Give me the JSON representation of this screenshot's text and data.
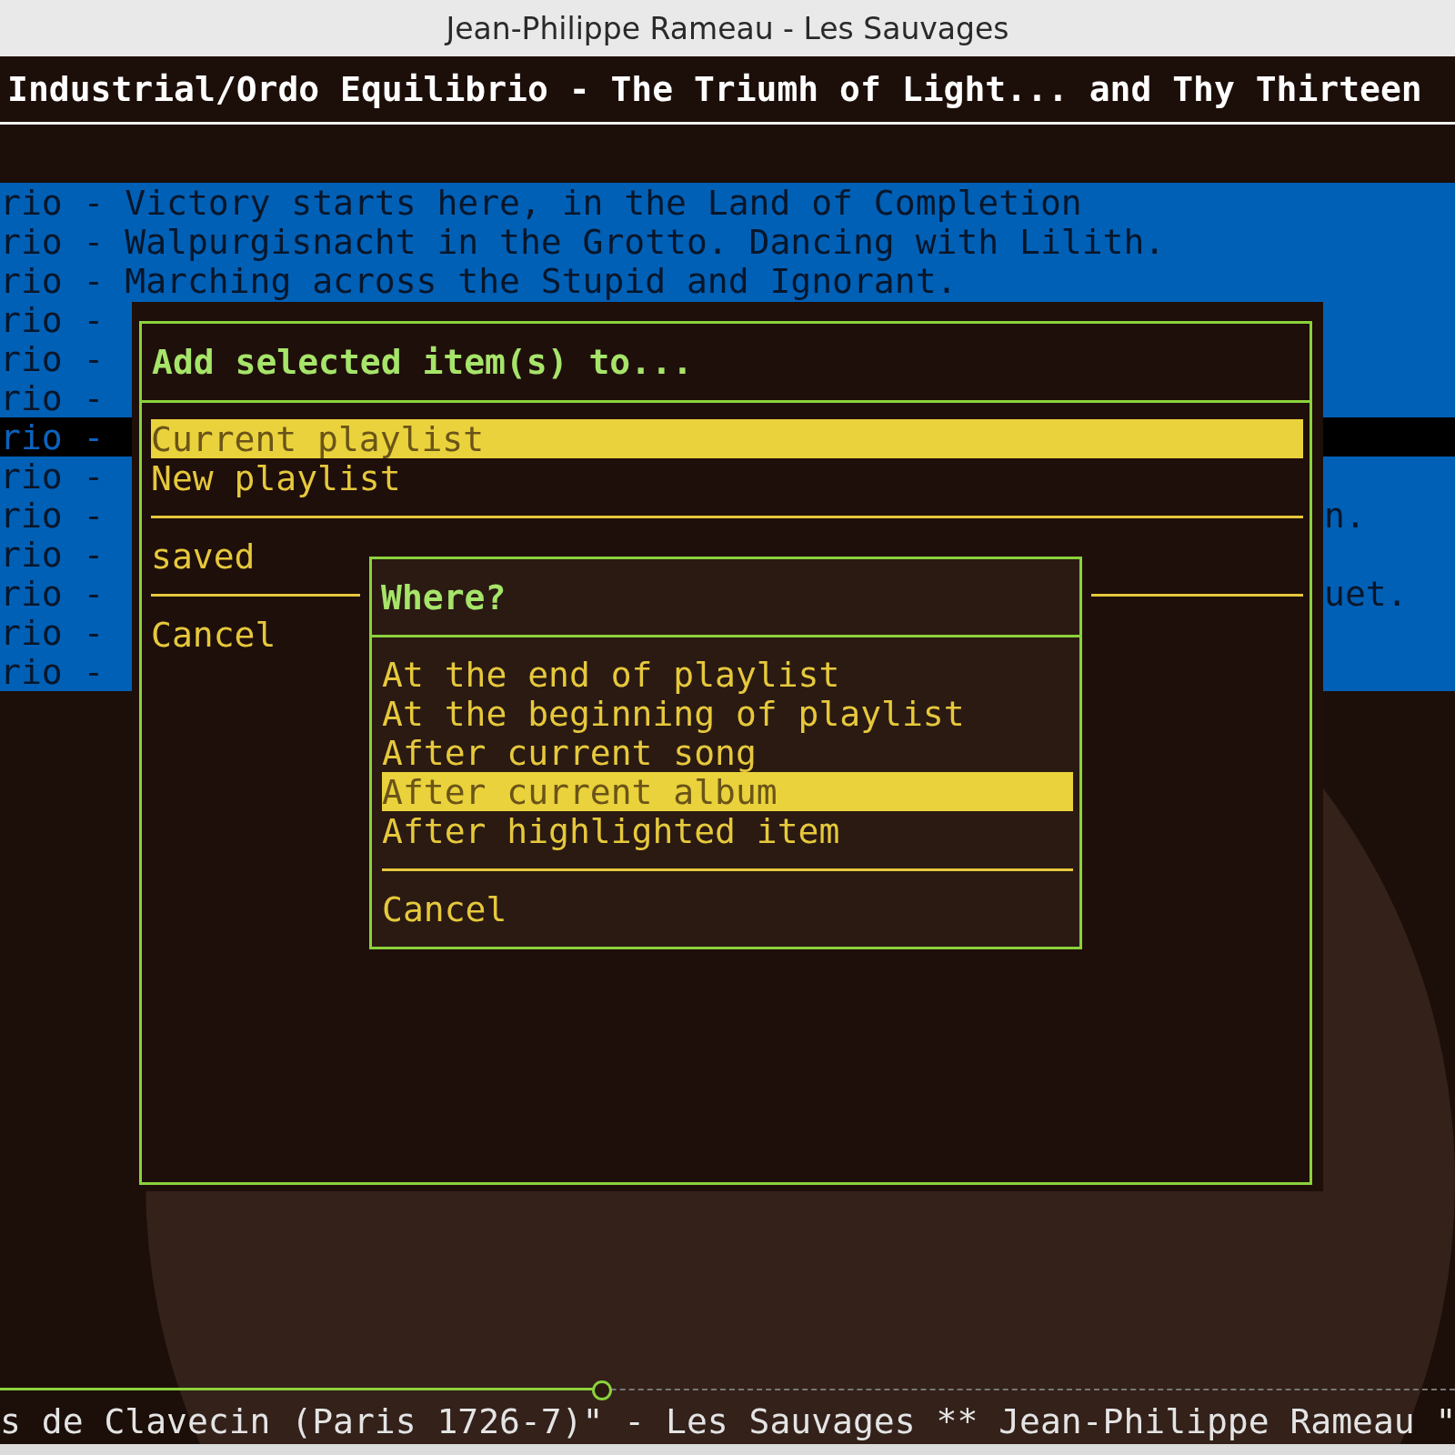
{
  "window": {
    "title": "Jean-Philippe Rameau - Les Sauvages"
  },
  "header": {
    "text": "Industrial/Ordo Equilibrio - The Triumh of Light... and Thy Thirteen"
  },
  "playlist": {
    "rows": [
      {
        "text": "rio - Victory starts here, in the Land of Completion",
        "selected": true,
        "highlighted": false
      },
      {
        "text": "rio - Walpurgisnacht in the Grotto. Dancing with Lilith.",
        "selected": true,
        "highlighted": false
      },
      {
        "text": "rio - Marching across the Stupid and Ignorant.",
        "selected": true,
        "highlighted": false
      },
      {
        "text": "rio -",
        "selected": true,
        "highlighted": false
      },
      {
        "text": "rio -",
        "selected": true,
        "highlighted": false
      },
      {
        "text": "rio -",
        "selected": true,
        "highlighted": false
      },
      {
        "text": "rio -",
        "selected": true,
        "highlighted": true
      },
      {
        "text": "rio -",
        "selected": true,
        "highlighted": false
      },
      {
        "text": "rio -",
        "end_text": "n.",
        "selected": true,
        "highlighted": false
      },
      {
        "text": "rio -",
        "selected": true,
        "highlighted": false
      },
      {
        "text": "rio -",
        "end_text": "uet.",
        "selected": true,
        "highlighted": false
      },
      {
        "text": "rio -",
        "selected": true,
        "highlighted": false
      },
      {
        "text": "rio -",
        "selected": true,
        "highlighted": false
      }
    ]
  },
  "add_dialog": {
    "title": "Add selected item(s) to...",
    "items": [
      {
        "kind": "option",
        "label": "Current playlist",
        "selected": true
      },
      {
        "kind": "option",
        "label": "New playlist",
        "selected": false
      },
      {
        "kind": "separator"
      },
      {
        "kind": "option",
        "label": "saved",
        "selected": false
      },
      {
        "kind": "separator"
      },
      {
        "kind": "option",
        "label": "Cancel",
        "selected": false
      }
    ]
  },
  "where_dialog": {
    "title": "Where?",
    "items": [
      {
        "kind": "option",
        "label": "At the end of playlist",
        "selected": false
      },
      {
        "kind": "option",
        "label": "At the beginning of playlist",
        "selected": false
      },
      {
        "kind": "option",
        "label": "After current song",
        "selected": false
      },
      {
        "kind": "option",
        "label": "After current album",
        "selected": true
      },
      {
        "kind": "option",
        "label": "After highlighted item",
        "selected": false
      },
      {
        "kind": "separator"
      },
      {
        "kind": "option",
        "label": "Cancel",
        "selected": false
      }
    ]
  },
  "status_bar": {
    "progress": {
      "level": 0.413
    },
    "text": "s de Clavecin (Paris 1726-7)\" - Les Sauvages ** Jean-Philippe Rameau \""
  }
}
